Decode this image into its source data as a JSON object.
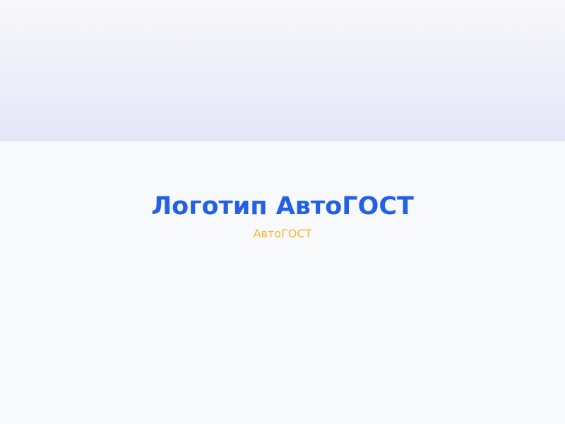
{
  "main": {
    "title": "Логотип АвтоГОСТ",
    "subtitle": "АвтоГОСТ"
  },
  "colors": {
    "background": "#f8f9fb",
    "header_gradient_top": "#f8f8fb",
    "header_gradient_bottom": "#e5e5f9",
    "title": "#2460e6",
    "subtitle": "#f2b82b"
  }
}
